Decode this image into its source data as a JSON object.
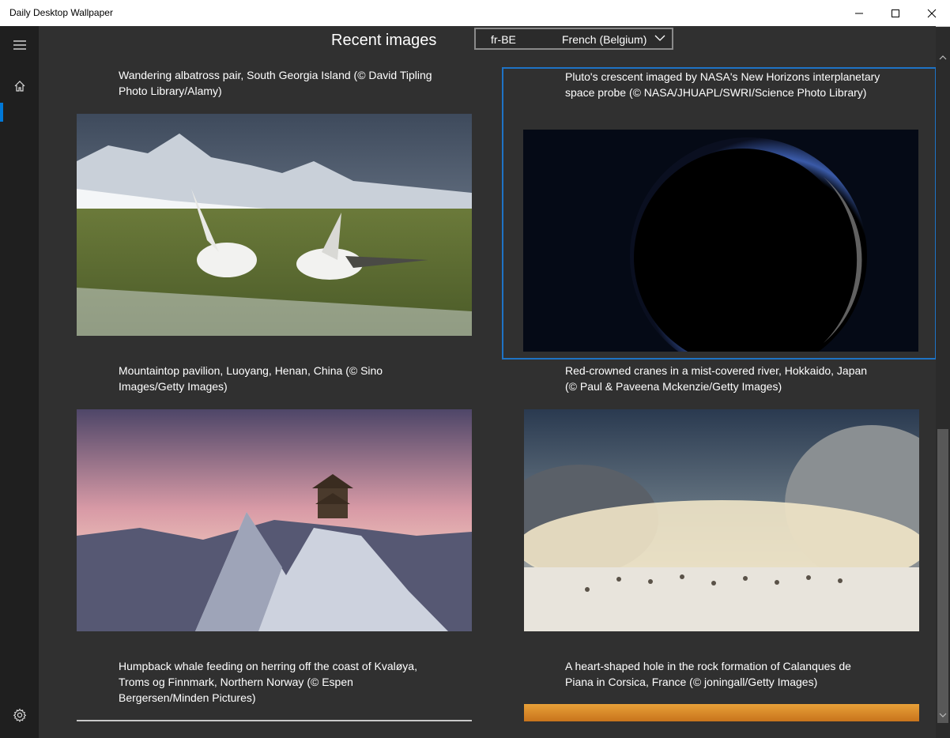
{
  "window": {
    "title": "Daily Desktop Wallpaper"
  },
  "header": {
    "title": "Recent images",
    "language": {
      "code": "fr-BE",
      "name": "French (Belgium)"
    }
  },
  "nav": {
    "items": [
      "hamburger-menu",
      "home",
      "settings"
    ]
  },
  "images": [
    {
      "caption": "Wandering albatross pair, South Georgia Island (© David Tipling Photo Library/Alamy)"
    },
    {
      "caption": "Pluto's crescent imaged by NASA's New Horizons interplanetary space probe (© NASA/JHUAPL/SWRI/Science Photo Library)",
      "selected": true
    },
    {
      "caption": "Mountaintop pavilion, Luoyang, Henan, China (© Sino Images/Getty Images)"
    },
    {
      "caption": "Red-crowned cranes in a mist-covered river, Hokkaido, Japan (© Paul & Paveena Mckenzie/Getty Images)"
    },
    {
      "caption": "Humpback whale feeding on herring off the coast of Kvaløya, Troms og Finnmark, Northern Norway (© Espen Bergersen/Minden Pictures)"
    },
    {
      "caption": "A heart-shaped hole in the rock formation of Calanques de Piana in Corsica, France (© joningall/Getty Images)"
    }
  ],
  "colors": {
    "accent": "#0078d7",
    "selection_border": "#1e73c5"
  }
}
